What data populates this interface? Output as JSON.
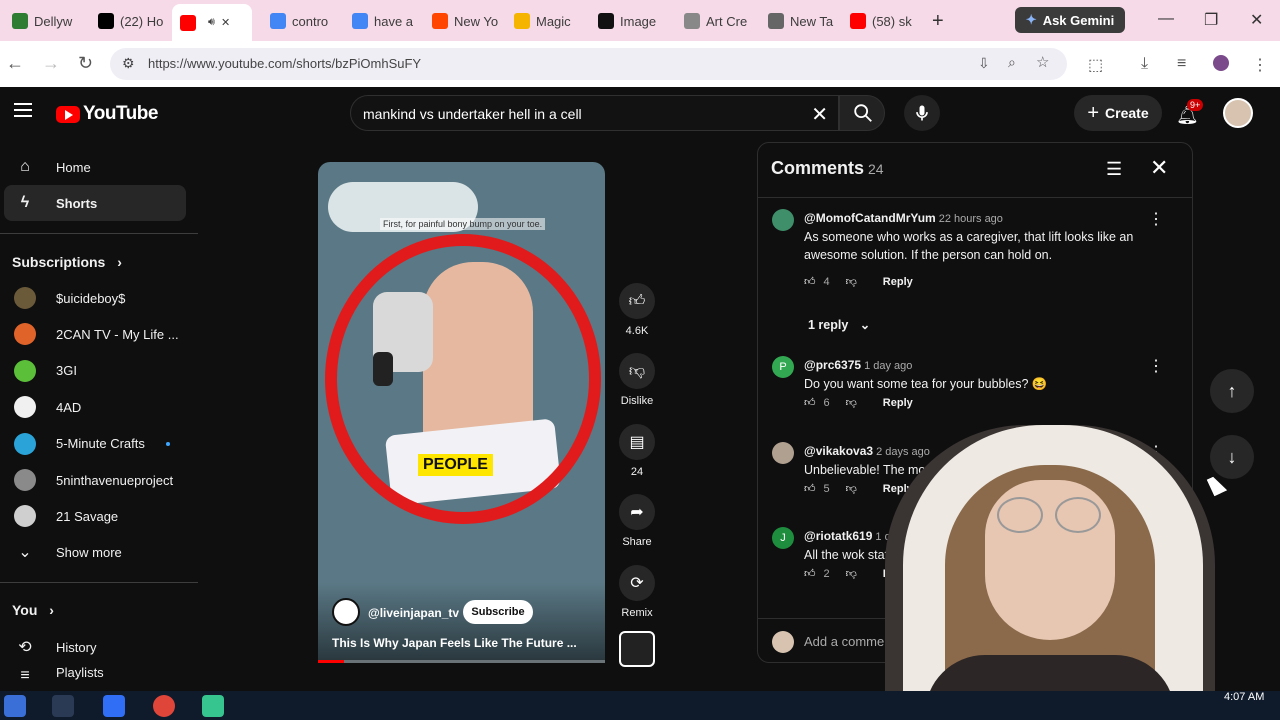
{
  "browser": {
    "tabs": [
      {
        "label": "Dellyw",
        "favicon": "green-k-icon",
        "color": "#2e7d32"
      },
      {
        "label": "(22) Ho",
        "favicon": "x-icon",
        "color": "#000000"
      },
      {
        "label": "",
        "favicon": "youtube-icon",
        "color": "#ff0000",
        "active": true
      },
      {
        "label": "contro",
        "favicon": "google-icon",
        "color": "#4285f4"
      },
      {
        "label": "have a",
        "favicon": "google-icon",
        "color": "#4285f4"
      },
      {
        "label": "New Yo",
        "favicon": "reddit-icon",
        "color": "#ff4500"
      },
      {
        "label": "Magic",
        "favicon": "s-icon",
        "color": "#f4b400"
      },
      {
        "label": "Image",
        "favicon": "openai-icon",
        "color": "#111111"
      },
      {
        "label": "Art Cre",
        "favicon": "openai-icon",
        "color": "#888888"
      },
      {
        "label": "New Ta",
        "favicon": "chrome-icon",
        "color": "#666666"
      },
      {
        "label": "(58) sk",
        "favicon": "youtube-icon",
        "color": "#ff0000"
      }
    ],
    "new_tab": "+",
    "gemini_label": "Ask Gemini",
    "url": "https://www.youtube.com/shorts/bzPiOmhSuFY"
  },
  "youtube": {
    "logo_text": "YouTube",
    "search_query": "mankind vs undertaker hell in a cell",
    "create_label": "Create",
    "notifications_badge": "9+"
  },
  "sidebar": {
    "main": [
      {
        "label": "Home",
        "icon": "home-icon"
      },
      {
        "label": "Shorts",
        "icon": "shorts-icon",
        "active": true
      }
    ],
    "subscriptions_title": "Subscriptions",
    "subscriptions": [
      {
        "label": "$uicideboy$",
        "color": "#6b5a3a"
      },
      {
        "label": "2CAN TV - My Life ...",
        "color": "#e0642a"
      },
      {
        "label": "3GI",
        "color": "#5bbf3a"
      },
      {
        "label": "4AD",
        "color": "#f0f0f0"
      },
      {
        "label": "5-Minute Crafts",
        "color": "#2aa4d8",
        "new": true
      },
      {
        "label": "5ninthavenueproject",
        "color": "#8a8a8a"
      },
      {
        "label": "21 Savage",
        "color": "#cfcfcf"
      }
    ],
    "show_more": "Show more",
    "you_title": "You",
    "you_items": [
      {
        "label": "History",
        "icon": "history-icon"
      },
      {
        "label": "Playlists",
        "icon": "playlists-icon"
      }
    ]
  },
  "short": {
    "caption": "First, for painful bony bump on your toe.",
    "overlay_word": "PEOPLE",
    "channel": "@liveinjapan_tv",
    "subscribe": "Subscribe",
    "title": "This Is Why Japan Feels Like The Future ...",
    "progress": 0.09,
    "actions": {
      "like": "4.6K",
      "dislike": "Dislike",
      "comments": "24",
      "share": "Share",
      "remix": "Remix"
    }
  },
  "comments_panel": {
    "title": "Comments",
    "count": "24",
    "items": [
      {
        "author": "@MomofCatandMrYum",
        "time": "22 hours ago",
        "text": "As someone who works as a caregiver, that lift looks like an awesome solution. If the person can hold on.",
        "likes": "4",
        "reply": "Reply",
        "avatar_color": "#3f8f6a"
      },
      {
        "author": "@prc6375",
        "time": "1 day ago",
        "text": "Do you want some tea for your bubbles? 😆",
        "likes": "6",
        "reply": "Reply",
        "avatar_color": "#33a852",
        "initial": "P"
      },
      {
        "author": "@vikakova3",
        "time": "2 days ago",
        "text": "Unbelievable! The moving tool",
        "likes": "5",
        "reply": "Reply",
        "avatar_color": "#b0a090"
      },
      {
        "author": "@riotatk619",
        "time": "1 day ago",
        "text": "All the wok stations ev",
        "likes": "2",
        "reply": "Reply",
        "avatar_color": "#1e8e3e",
        "initial": "J"
      }
    ],
    "replies_toggle": "1 reply",
    "add_comment_placeholder": "Add a comment..."
  },
  "taskbar": {
    "clock": "4:07 AM"
  }
}
